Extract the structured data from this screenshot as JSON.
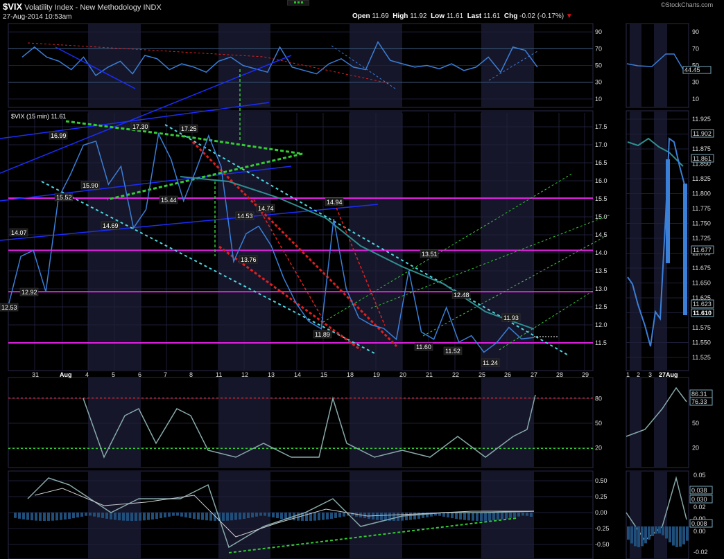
{
  "header": {
    "symbol": "$VIX",
    "name": "Volatility Index - New Methodology",
    "exchange": "INDX",
    "datetime": "27-Aug-2014 10:53am",
    "open_label": "Open",
    "open": "11.69",
    "high_label": "High",
    "high": "11.92",
    "low_label": "Low",
    "low": "11.61",
    "last_label": "Last",
    "last": "11.61",
    "chg_label": "Chg",
    "chg": "-0.02 (-0.17%)",
    "brand": "©StockCharts.com"
  },
  "colors": {
    "price": "#3a7fd8",
    "ma": "#2f8f8f",
    "grid": "#1e1e38",
    "band": "#16162a",
    "magenta": "#e020e0",
    "cyan": "#4dd8e0",
    "green": "#33cc33",
    "red": "#e02020",
    "blue": "#1a2dff"
  },
  "chart_data": [
    {
      "type": "line",
      "panel": "rsi-top",
      "series": [
        {
          "values": [
            60,
            72,
            60,
            55,
            45,
            60,
            38,
            48,
            55,
            40,
            62,
            58,
            45,
            52,
            48,
            42,
            55,
            60,
            50,
            46,
            42,
            72,
            48,
            44,
            40,
            52,
            58,
            48,
            45,
            78,
            56,
            52,
            48,
            50,
            46,
            52,
            44,
            48,
            60,
            42,
            72,
            68,
            48
          ]
        }
      ],
      "y_ticks": [
        "90",
        "70",
        "50",
        "30",
        "10"
      ],
      "ylim": [
        0,
        100
      ]
    },
    {
      "type": "line",
      "panel": "price",
      "title": "$VIX (15 min) 11.61",
      "x_ticks": [
        "31",
        "Aug",
        "4",
        "5",
        "6",
        "7",
        "8",
        "11",
        "12",
        "13",
        "14",
        "15",
        "18",
        "19",
        "20",
        "21",
        "22",
        "25",
        "26",
        "27",
        "28",
        "29"
      ],
      "y_ticks": [
        "17.5",
        "17.0",
        "16.5",
        "16.0",
        "15.5",
        "15.0",
        "14.5",
        "14.0",
        "13.5",
        "13.0",
        "12.5",
        "12.0",
        "11.5"
      ],
      "ylim": [
        11.0,
        17.8
      ],
      "series": [
        {
          "values": [
            12.53,
            13.9,
            14.07,
            12.92,
            15.52,
            16.2,
            16.99,
            17.1,
            15.9,
            16.4,
            14.69,
            15.2,
            17.3,
            16.6,
            15.44,
            16.3,
            17.25,
            16.4,
            13.76,
            14.53,
            14.74,
            14.2,
            13.3,
            12.6,
            12.1,
            11.89,
            14.94,
            13.0,
            12.2,
            12.0,
            11.9,
            11.6,
            13.51,
            11.8,
            11.6,
            12.48,
            11.52,
            11.7,
            11.24,
            11.5,
            11.93,
            11.61,
            11.65
          ]
        }
      ],
      "labels": [
        "12.53",
        "14.07",
        "12.92",
        "15.52",
        "16.99",
        "15.90",
        "14.69",
        "17.30",
        "15.44",
        "17.25",
        "13.76",
        "14.53",
        "14.74",
        "11.89",
        "14.94",
        "13.51",
        "11.60",
        "12.48",
        "11.52",
        "11.24",
        "11.93"
      ]
    },
    {
      "type": "line",
      "panel": "price-daily-right",
      "y_ticks": [
        "11.925",
        "11.900",
        "11.875",
        "11.850",
        "11.825",
        "11.800",
        "11.775",
        "11.750",
        "11.725",
        "11.700",
        "11.675",
        "11.650",
        "11.625",
        "11.600",
        "11.575",
        "11.550",
        "11.525"
      ],
      "value_labels": [
        "11.902",
        "11.861",
        "11.677",
        "11.623",
        "11.610"
      ],
      "x_ticks": [
        "1",
        "2",
        "3",
        "27Aug"
      ]
    },
    {
      "type": "line",
      "panel": "stoch",
      "y_ticks": [
        "80",
        "50",
        "20"
      ],
      "value_labels": [
        "86.31",
        "76.33"
      ],
      "ylim": [
        0,
        100
      ]
    },
    {
      "type": "line",
      "panel": "macd",
      "y_ticks": [
        "0.50",
        "0.25",
        "0.00",
        "-0.25",
        "-0.50"
      ],
      "right_y_ticks": [
        "0.05",
        "0.04",
        "0.02",
        "0.00",
        "-0.02"
      ],
      "value_labels": [
        "0.038",
        "0.030",
        "0.008"
      ],
      "ylim": [
        -0.6,
        0.6
      ]
    }
  ]
}
